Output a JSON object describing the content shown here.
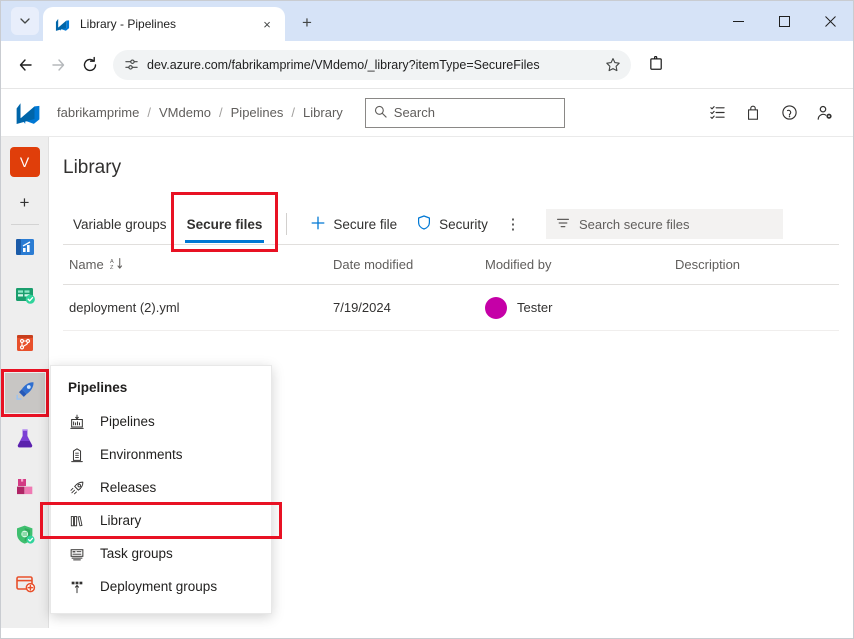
{
  "browser": {
    "tab": {
      "title": "Library - Pipelines",
      "favicon": "azure-devops-icon",
      "close": "×"
    },
    "tab_list_chevron": "⌄",
    "new_tab": "+",
    "window_controls": {
      "minimize": "─",
      "maximize": "□",
      "close": "✕"
    },
    "nav": {
      "back": "←",
      "forward": "→",
      "reload": "⟳"
    },
    "omnibox": {
      "url": "dev.azure.com/fabrikamprime/VMdemo/_library?itemType=SecureFiles",
      "site_icon": "site-settings-icon",
      "bookmark": "☆"
    },
    "extensions": "extensions-icon"
  },
  "ado_header": {
    "logo": "azure-devops-logo",
    "breadcrumb": [
      {
        "label": "fabrikamprime"
      },
      {
        "label": "VMdemo"
      },
      {
        "label": "Pipelines"
      },
      {
        "label": "Library"
      }
    ],
    "separator": "/",
    "search": {
      "placeholder": "Search",
      "icon": "search-icon"
    },
    "icons": [
      {
        "name": "checklist-icon"
      },
      {
        "name": "shopping-bag-icon"
      },
      {
        "name": "help-icon"
      },
      {
        "name": "user-settings-icon"
      }
    ]
  },
  "rail": {
    "project_initial": "V",
    "add": "+",
    "items": [
      {
        "name": "overview-icon",
        "active": false
      },
      {
        "name": "boards-icon",
        "active": false
      },
      {
        "name": "repos-icon",
        "active": false
      },
      {
        "name": "pipelines-icon",
        "active": true
      },
      {
        "name": "test-plans-icon",
        "active": false
      },
      {
        "name": "artifacts-icon",
        "active": false
      },
      {
        "name": "security-icon",
        "active": false
      },
      {
        "name": "billing-icon",
        "active": false
      }
    ]
  },
  "main": {
    "title": "Library",
    "pivots": [
      {
        "label": "Variable groups",
        "selected": false,
        "highlight": false
      },
      {
        "label": "Secure files",
        "selected": true,
        "highlight": true
      }
    ],
    "commands": [
      {
        "label": "Secure file",
        "icon": "plus-icon"
      },
      {
        "label": "Security",
        "icon": "shield-icon"
      }
    ],
    "more_commands": "⋮",
    "filter": {
      "placeholder": "Search secure files",
      "icon": "filter-icon"
    },
    "grid": {
      "columns": [
        {
          "label": "Name",
          "sort": "sort-ascending-icon"
        },
        {
          "label": "Date modified"
        },
        {
          "label": "Modified by"
        },
        {
          "label": "Description"
        }
      ],
      "rows": [
        {
          "name": "deployment (2).yml",
          "date_modified": "7/19/2024",
          "modified_by": "Tester",
          "avatar_color": "#c500a7",
          "description": ""
        }
      ]
    }
  },
  "flyout": {
    "title": "Pipelines",
    "items": [
      {
        "label": "Pipelines",
        "icon": "pipelines-icon",
        "highlight": false
      },
      {
        "label": "Environments",
        "icon": "environments-icon",
        "highlight": false
      },
      {
        "label": "Releases",
        "icon": "releases-rocket-icon",
        "highlight": false
      },
      {
        "label": "Library",
        "icon": "library-icon",
        "highlight": true
      },
      {
        "label": "Task groups",
        "icon": "task-groups-icon",
        "highlight": false
      },
      {
        "label": "Deployment groups",
        "icon": "deployment-groups-icon",
        "highlight": false
      }
    ]
  },
  "colors": {
    "accent": "#0078d4",
    "highlight": "#e81123",
    "avatar": "#c500a7",
    "project": "#e03e0a"
  }
}
